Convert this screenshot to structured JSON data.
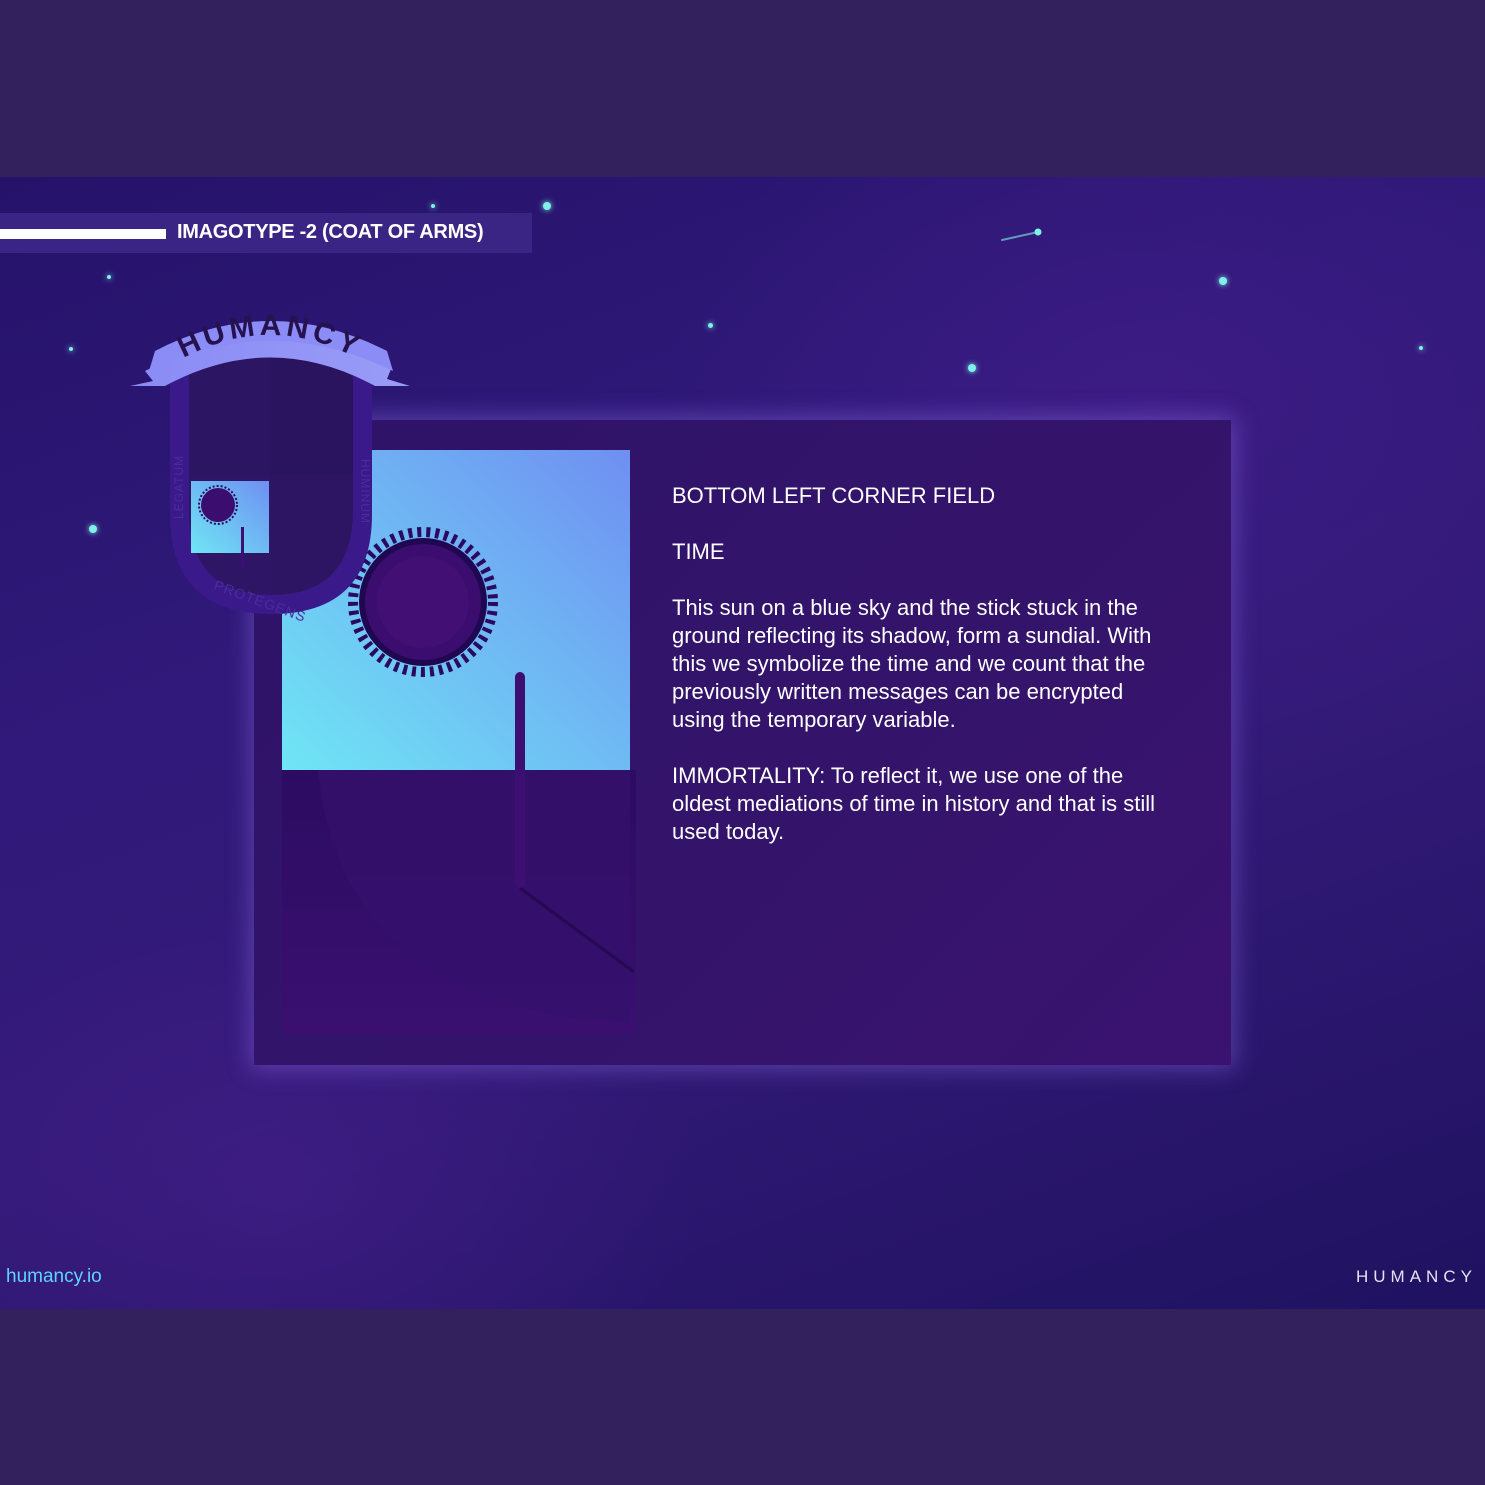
{
  "header": {
    "title": "IMAGOTYPE -2 (COAT OF ARMS)"
  },
  "crest": {
    "banner": "HUMANCY",
    "left_motto": "LEGATUM",
    "right_motto": "HUMINUM",
    "bottom_motto": "PROTEGENS"
  },
  "card": {
    "heading": "BOTTOM LEFT CORNER FIELD",
    "subheading": "TIME",
    "body": "This sun on a blue sky and the stick stuck in the ground reflecting its shadow, form a sundial. With this we symbolize the time and we count that the previously written messages can be encrypted using the temporary variable.",
    "immortality": "IMMORTALITY: To reflect it, we use one of the oldest mediations of time in history and that is still used today."
  },
  "footer": {
    "website": "humancy.io",
    "brand": "HUMANCY"
  },
  "colors": {
    "background": "#33215e",
    "slide": "#2a1670",
    "accent_cyan": "#7ff2e8",
    "sky_light": "#6fe6f5",
    "sky_dark": "#6f8ff2",
    "ground": "#2e0d66",
    "link": "#5fd3ff"
  }
}
